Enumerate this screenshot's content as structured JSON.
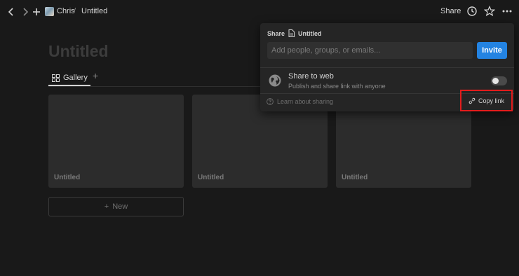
{
  "topbar": {
    "breadcrumb_user": "Chris",
    "breadcrumb_sep": "/",
    "breadcrumb_page": "Untitled",
    "share_label": "Share"
  },
  "page": {
    "title": "Untitled",
    "tab_label": "Gallery",
    "cards": [
      "Untitled",
      "Untitled",
      "Untitled"
    ],
    "new_label": "New"
  },
  "share_popover": {
    "header_label": "Share",
    "header_page": "Untitled",
    "input_placeholder": "Add people, groups, or emails...",
    "invite_label": "Invite",
    "web_title": "Share to web",
    "web_desc": "Publish and share link with anyone",
    "web_enabled": false,
    "learn_label": "Learn about sharing",
    "copy_link_label": "Copy link"
  },
  "colors": {
    "background": "#191919",
    "accent": "#2383e2",
    "highlight": "#e31c1c"
  }
}
